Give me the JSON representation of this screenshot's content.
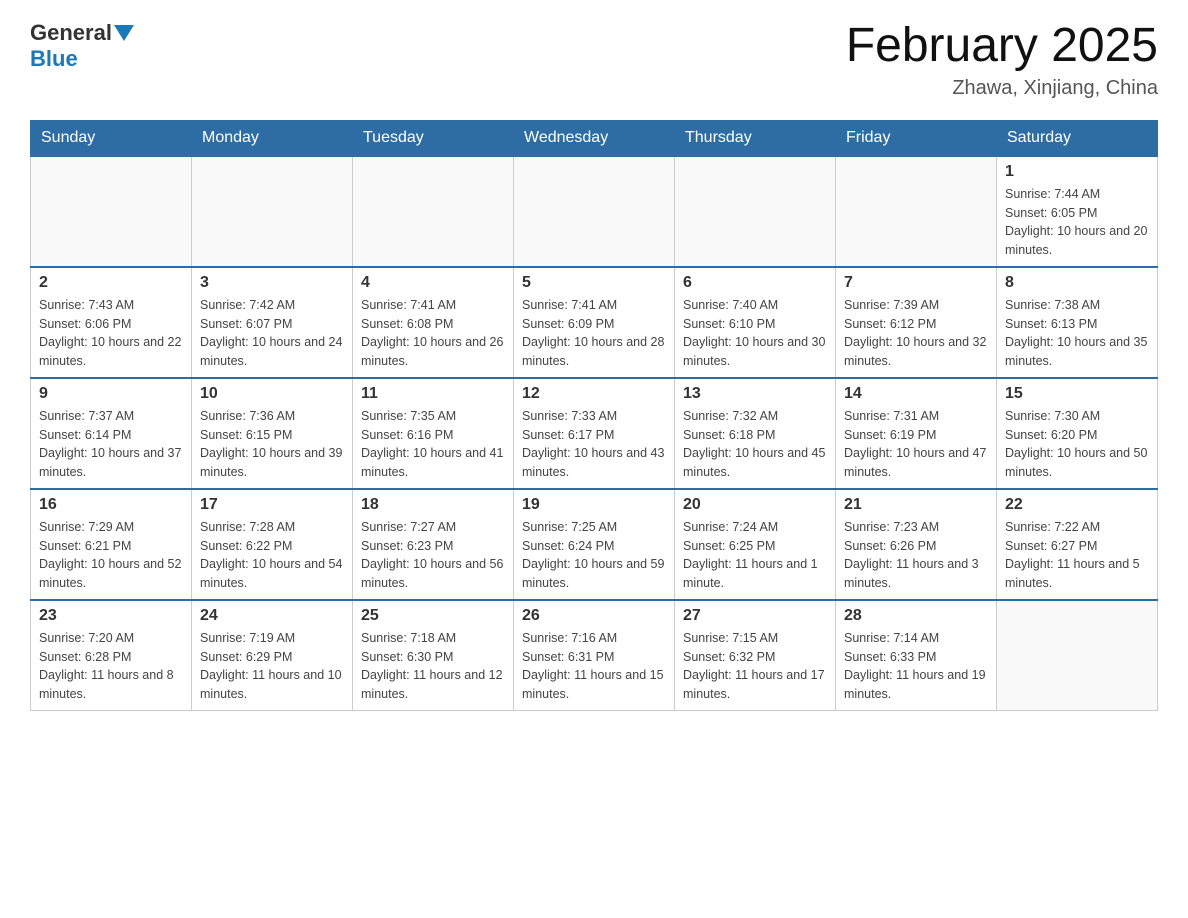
{
  "header": {
    "logo_general": "General",
    "logo_blue": "Blue",
    "month_title": "February 2025",
    "location": "Zhawa, Xinjiang, China"
  },
  "days_of_week": [
    "Sunday",
    "Monday",
    "Tuesday",
    "Wednesday",
    "Thursday",
    "Friday",
    "Saturday"
  ],
  "weeks": [
    [
      {
        "day": "",
        "info": ""
      },
      {
        "day": "",
        "info": ""
      },
      {
        "day": "",
        "info": ""
      },
      {
        "day": "",
        "info": ""
      },
      {
        "day": "",
        "info": ""
      },
      {
        "day": "",
        "info": ""
      },
      {
        "day": "1",
        "info": "Sunrise: 7:44 AM\nSunset: 6:05 PM\nDaylight: 10 hours and 20 minutes."
      }
    ],
    [
      {
        "day": "2",
        "info": "Sunrise: 7:43 AM\nSunset: 6:06 PM\nDaylight: 10 hours and 22 minutes."
      },
      {
        "day": "3",
        "info": "Sunrise: 7:42 AM\nSunset: 6:07 PM\nDaylight: 10 hours and 24 minutes."
      },
      {
        "day": "4",
        "info": "Sunrise: 7:41 AM\nSunset: 6:08 PM\nDaylight: 10 hours and 26 minutes."
      },
      {
        "day": "5",
        "info": "Sunrise: 7:41 AM\nSunset: 6:09 PM\nDaylight: 10 hours and 28 minutes."
      },
      {
        "day": "6",
        "info": "Sunrise: 7:40 AM\nSunset: 6:10 PM\nDaylight: 10 hours and 30 minutes."
      },
      {
        "day": "7",
        "info": "Sunrise: 7:39 AM\nSunset: 6:12 PM\nDaylight: 10 hours and 32 minutes."
      },
      {
        "day": "8",
        "info": "Sunrise: 7:38 AM\nSunset: 6:13 PM\nDaylight: 10 hours and 35 minutes."
      }
    ],
    [
      {
        "day": "9",
        "info": "Sunrise: 7:37 AM\nSunset: 6:14 PM\nDaylight: 10 hours and 37 minutes."
      },
      {
        "day": "10",
        "info": "Sunrise: 7:36 AM\nSunset: 6:15 PM\nDaylight: 10 hours and 39 minutes."
      },
      {
        "day": "11",
        "info": "Sunrise: 7:35 AM\nSunset: 6:16 PM\nDaylight: 10 hours and 41 minutes."
      },
      {
        "day": "12",
        "info": "Sunrise: 7:33 AM\nSunset: 6:17 PM\nDaylight: 10 hours and 43 minutes."
      },
      {
        "day": "13",
        "info": "Sunrise: 7:32 AM\nSunset: 6:18 PM\nDaylight: 10 hours and 45 minutes."
      },
      {
        "day": "14",
        "info": "Sunrise: 7:31 AM\nSunset: 6:19 PM\nDaylight: 10 hours and 47 minutes."
      },
      {
        "day": "15",
        "info": "Sunrise: 7:30 AM\nSunset: 6:20 PM\nDaylight: 10 hours and 50 minutes."
      }
    ],
    [
      {
        "day": "16",
        "info": "Sunrise: 7:29 AM\nSunset: 6:21 PM\nDaylight: 10 hours and 52 minutes."
      },
      {
        "day": "17",
        "info": "Sunrise: 7:28 AM\nSunset: 6:22 PM\nDaylight: 10 hours and 54 minutes."
      },
      {
        "day": "18",
        "info": "Sunrise: 7:27 AM\nSunset: 6:23 PM\nDaylight: 10 hours and 56 minutes."
      },
      {
        "day": "19",
        "info": "Sunrise: 7:25 AM\nSunset: 6:24 PM\nDaylight: 10 hours and 59 minutes."
      },
      {
        "day": "20",
        "info": "Sunrise: 7:24 AM\nSunset: 6:25 PM\nDaylight: 11 hours and 1 minute."
      },
      {
        "day": "21",
        "info": "Sunrise: 7:23 AM\nSunset: 6:26 PM\nDaylight: 11 hours and 3 minutes."
      },
      {
        "day": "22",
        "info": "Sunrise: 7:22 AM\nSunset: 6:27 PM\nDaylight: 11 hours and 5 minutes."
      }
    ],
    [
      {
        "day": "23",
        "info": "Sunrise: 7:20 AM\nSunset: 6:28 PM\nDaylight: 11 hours and 8 minutes."
      },
      {
        "day": "24",
        "info": "Sunrise: 7:19 AM\nSunset: 6:29 PM\nDaylight: 11 hours and 10 minutes."
      },
      {
        "day": "25",
        "info": "Sunrise: 7:18 AM\nSunset: 6:30 PM\nDaylight: 11 hours and 12 minutes."
      },
      {
        "day": "26",
        "info": "Sunrise: 7:16 AM\nSunset: 6:31 PM\nDaylight: 11 hours and 15 minutes."
      },
      {
        "day": "27",
        "info": "Sunrise: 7:15 AM\nSunset: 6:32 PM\nDaylight: 11 hours and 17 minutes."
      },
      {
        "day": "28",
        "info": "Sunrise: 7:14 AM\nSunset: 6:33 PM\nDaylight: 11 hours and 19 minutes."
      },
      {
        "day": "",
        "info": ""
      }
    ]
  ]
}
